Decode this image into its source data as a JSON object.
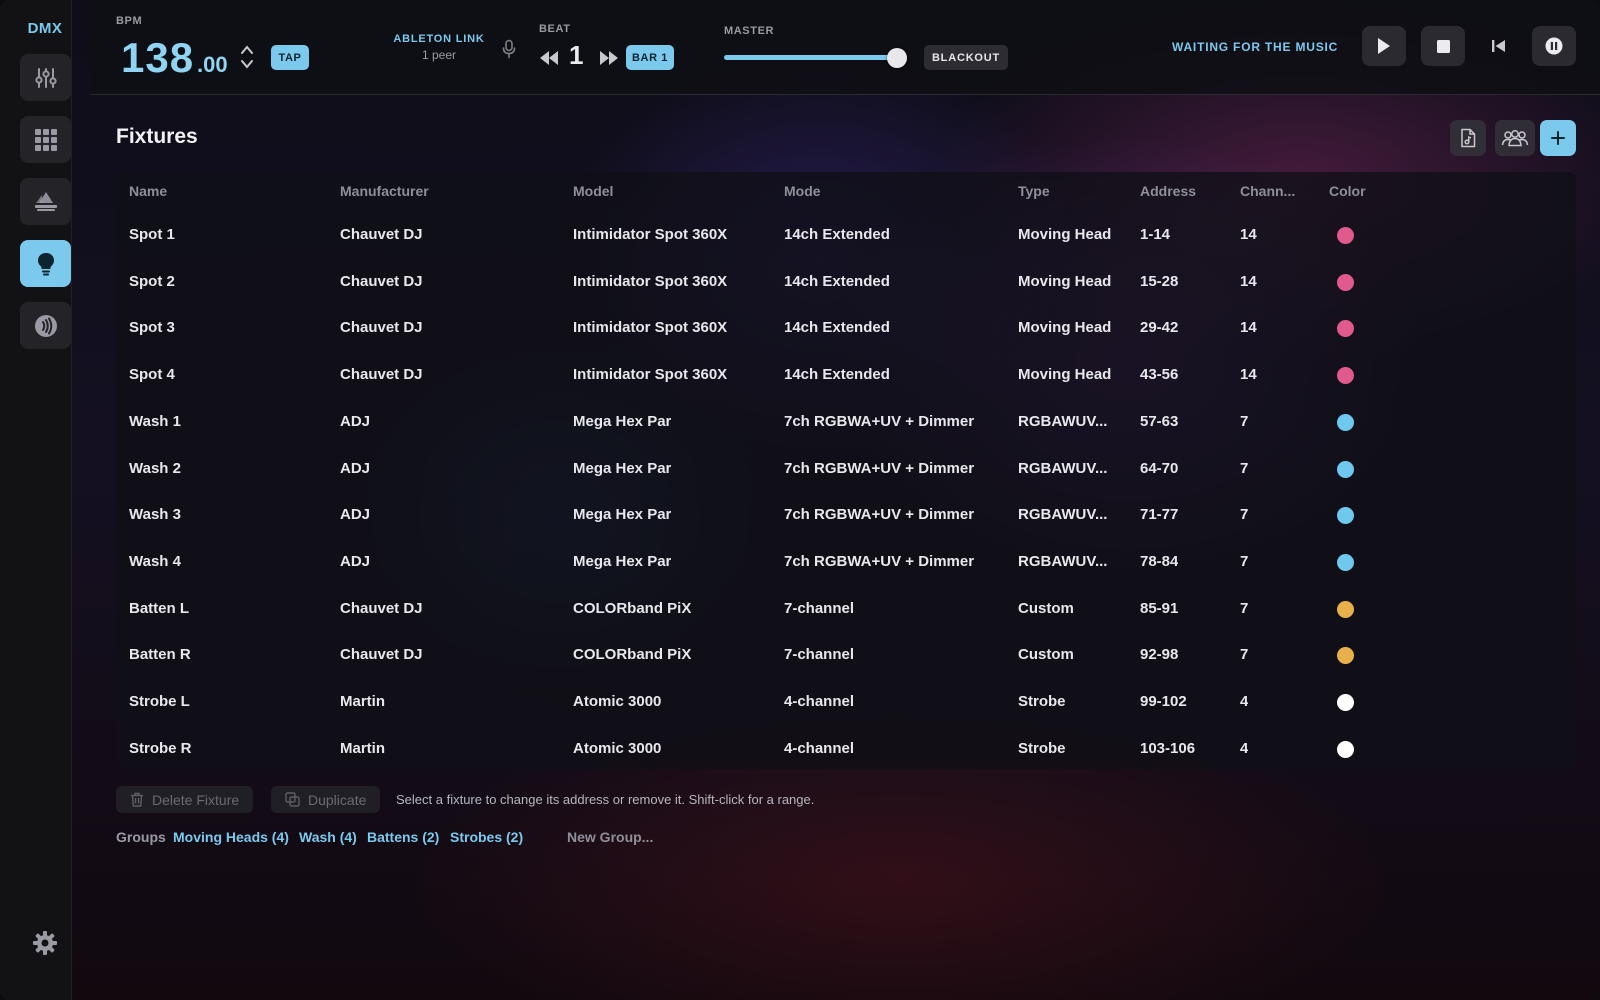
{
  "app": {
    "logo": "DMX"
  },
  "sidebar": {
    "items": [
      {
        "icon": "sliders-icon",
        "active": false
      },
      {
        "icon": "grid-icon",
        "active": false
      },
      {
        "icon": "stage-icon",
        "active": false
      },
      {
        "icon": "bulb-icon",
        "active": true
      },
      {
        "icon": "audio-icon",
        "active": false
      }
    ],
    "settings_icon": "gear-icon"
  },
  "topbar": {
    "bpm_label": "BPM",
    "bpm_int": "138",
    "bpm_dec": ".00",
    "tap_label": "TAP",
    "link_title": "ABLETON LINK",
    "link_sub": "1 peer",
    "beat_label": "BEAT",
    "beat_value": "1",
    "bar_label": "BAR 1",
    "master_label": "MASTER",
    "master_level": 0.97,
    "blackout_label": "BLACKOUT",
    "status": "WAITING FOR THE MUSIC"
  },
  "main": {
    "title": "Fixtures",
    "columns": [
      "Name",
      "Manufacturer",
      "Model",
      "Mode",
      "Type",
      "Address",
      "Chann...",
      "Color"
    ],
    "rows": [
      {
        "name": "Spot 1",
        "manufacturer": "Chauvet DJ",
        "model": "Intimidator Spot 360X",
        "mode": "14ch Extended",
        "type": "Moving Head",
        "address": "1-14",
        "channels": "14",
        "color": "#e05a8c"
      },
      {
        "name": "Spot 2",
        "manufacturer": "Chauvet DJ",
        "model": "Intimidator Spot 360X",
        "mode": "14ch Extended",
        "type": "Moving Head",
        "address": "15-28",
        "channels": "14",
        "color": "#e05a8c"
      },
      {
        "name": "Spot 3",
        "manufacturer": "Chauvet DJ",
        "model": "Intimidator Spot 360X",
        "mode": "14ch Extended",
        "type": "Moving Head",
        "address": "29-42",
        "channels": "14",
        "color": "#e05a8c"
      },
      {
        "name": "Spot 4",
        "manufacturer": "Chauvet DJ",
        "model": "Intimidator Spot 360X",
        "mode": "14ch Extended",
        "type": "Moving Head",
        "address": "43-56",
        "channels": "14",
        "color": "#e05a8c"
      },
      {
        "name": "Wash 1",
        "manufacturer": "ADJ",
        "model": "Mega Hex Par",
        "mode": "7ch RGBWA+UV + Dimmer",
        "type": "RGBAWUV...",
        "address": "57-63",
        "channels": "7",
        "color": "#6fc8ee"
      },
      {
        "name": "Wash 2",
        "manufacturer": "ADJ",
        "model": "Mega Hex Par",
        "mode": "7ch RGBWA+UV + Dimmer",
        "type": "RGBAWUV...",
        "address": "64-70",
        "channels": "7",
        "color": "#6fc8ee"
      },
      {
        "name": "Wash 3",
        "manufacturer": "ADJ",
        "model": "Mega Hex Par",
        "mode": "7ch RGBWA+UV + Dimmer",
        "type": "RGBAWUV...",
        "address": "71-77",
        "channels": "7",
        "color": "#6fc8ee"
      },
      {
        "name": "Wash 4",
        "manufacturer": "ADJ",
        "model": "Mega Hex Par",
        "mode": "7ch RGBWA+UV + Dimmer",
        "type": "RGBAWUV...",
        "address": "78-84",
        "channels": "7",
        "color": "#6fc8ee"
      },
      {
        "name": "Batten L",
        "manufacturer": "Chauvet DJ",
        "model": "COLORband PiX",
        "mode": "7-channel",
        "type": "Custom",
        "address": "85-91",
        "channels": "7",
        "color": "#e8b04a"
      },
      {
        "name": "Batten R",
        "manufacturer": "Chauvet DJ",
        "model": "COLORband PiX",
        "mode": "7-channel",
        "type": "Custom",
        "address": "92-98",
        "channels": "7",
        "color": "#e8b04a"
      },
      {
        "name": "Strobe L",
        "manufacturer": "Martin",
        "model": "Atomic 3000",
        "mode": "4-channel",
        "type": "Strobe",
        "address": "99-102",
        "channels": "4",
        "color": "#ffffff"
      },
      {
        "name": "Strobe R",
        "manufacturer": "Martin",
        "model": "Atomic 3000",
        "mode": "4-channel",
        "type": "Strobe",
        "address": "103-106",
        "channels": "4",
        "color": "#ffffff"
      }
    ],
    "delete_label": "Delete Fixture",
    "duplicate_label": "Duplicate",
    "hint": "Select a fixture to change its address or remove it. Shift-click for a range.",
    "groups_label": "Groups",
    "groups": [
      "Moving Heads (4)",
      "Wash (4)",
      "Battens (2)",
      "Strobes (2)"
    ],
    "new_group_label": "New Group..."
  },
  "colors": {
    "accent": "#7cc9ee"
  }
}
